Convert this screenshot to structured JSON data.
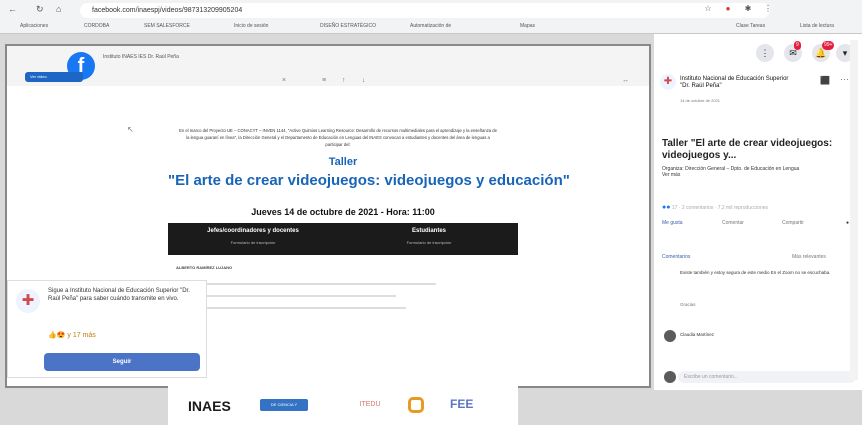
{
  "browser": {
    "url": "facebook.com/inaespj/videos/987313209905204",
    "bookmarks": [
      "Aplicaciones",
      "CORDOBA",
      "SEM SALESFORCE",
      "Inicio de sesión",
      "DISEÑO ESTRATÉGICO",
      "Automatización de",
      "Mapas",
      "Clase Tareas",
      "Lista de lectura"
    ]
  },
  "video": {
    "small_header": "Instituto INAES IES Dr. Raúl Peña",
    "left_button": "Ver video",
    "tool_icons": [
      "×",
      "≡",
      "↑",
      "↓",
      "↔"
    ],
    "intro_text": "En el marco del Proyecto UE – CONACYT – INVEN 1144, \"Active Quimios Learning Resource: Desarrollo de recursos multimediales para el aprendizaje y la enseñanza de la lengua guaraní en línea\", la Dirección General y el Departamento de Educación en Lenguas del INAES convocan a estudiantes y docentes del área de lenguas a participar del:",
    "taller": "Taller",
    "title": "\"El arte de crear videojuegos: videojuegos y educación\"",
    "date": "Jueves 14 de octubre de 2021 - Hora: 11:00",
    "col1_title": "Jefes/coordinadores y docentes",
    "col1_sub": "Formulario de inscripción",
    "col2_title": "Estudiantes",
    "col2_sub": "Formulario de inscripción",
    "speaker": "ALBERTO RAMÍREZ LUJANO",
    "logos": [
      "INAES",
      "DE CIENCIA Y TECNOLOGÍA",
      "ITEDU",
      "FEE"
    ]
  },
  "follow_card": {
    "text": "Sigue a Instituto Nacional de Educación Superior \"Dr. Raúl Peña\" para saber cuándo transmite en vivo.",
    "reactions": "👍😍 y 17 más",
    "button": "Seguir"
  },
  "right": {
    "page_name": "Instituto Nacional de Educación Superior \"Dr. Raúl Peña\"",
    "page_meta": "14 de octubre de 2021",
    "post_title": "Taller \"El arte de crear videojuegos: videojuegos y...",
    "organiza": "Organiza: Dirección General – Dpto. de Educación en Lengua",
    "ver_mas": "Ver más",
    "reactions_line": "17 · 2 comentarios · 7,2 mil reproducciones",
    "actions": [
      "Me gusta",
      "Comentar",
      "Compartir"
    ],
    "comments_label": "Comentarios",
    "comment_sort": "Más relevantes",
    "comments": [
      "Existe también y estoy segura de este medio En el Zoom no se escuchaba.",
      "Gracias"
    ],
    "commenter": "Claudia Martínez",
    "comment_placeholder": "Escribe un comentario..."
  }
}
